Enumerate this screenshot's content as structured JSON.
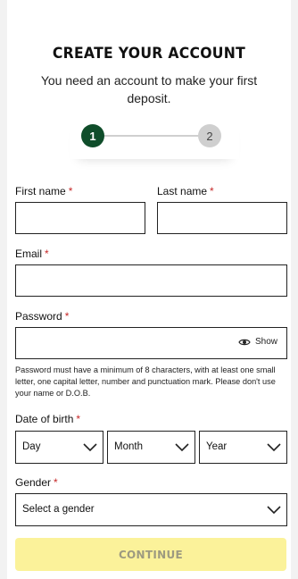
{
  "header": {
    "title": "CREATE YOUR ACCOUNT",
    "subtitle": "You need an account to make your first deposit."
  },
  "stepper": {
    "steps": [
      "1",
      "2"
    ],
    "current": 1
  },
  "form": {
    "first_name_label": "First name",
    "last_name_label": "Last name",
    "email_label": "Email",
    "password_label": "Password",
    "password_show_label": "Show",
    "password_hint": "Password must have a minimum of 8 characters, with at least one small letter, one capital letter, number and punctuation mark. Please don't use your name or D.O.B.",
    "dob_label": "Date of birth",
    "dob_day": "Day",
    "dob_month": "Month",
    "dob_year": "Year",
    "gender_label": "Gender",
    "gender_value": "Select a gender",
    "required_mark": "*"
  },
  "actions": {
    "continue_label": "CONTINUE"
  },
  "colors": {
    "step_active": "#0f4d2a",
    "step_inactive": "#cfcfcf",
    "required": "#c62828",
    "continue_bg": "#fbf29a"
  }
}
